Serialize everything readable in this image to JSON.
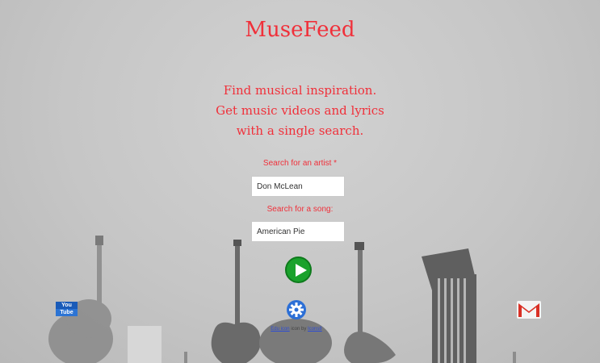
{
  "app": {
    "title": "MuseFeed"
  },
  "tagline": [
    "Find musical inspiration.",
    "Get music videos and lyrics",
    "with a single search."
  ],
  "form": {
    "artist_label": "Search for an artist",
    "artist_required": "*",
    "artist_value": "Don McLean",
    "song_label": "Search for a song:",
    "song_value": "American Pie"
  },
  "icons": {
    "youtube": {
      "name": "youtube-icon",
      "line1": "You",
      "line2": "Tube"
    },
    "play": "play-icon",
    "settings": "gear-icon",
    "gmail": "gmail-icon"
  },
  "credit": {
    "link1": "Edu icon",
    "middle": " icon by ",
    "link2": "Icons8"
  },
  "colors": {
    "accent": "#f0303a",
    "play": "#1aa22c",
    "settings": "#2c6fd6"
  }
}
